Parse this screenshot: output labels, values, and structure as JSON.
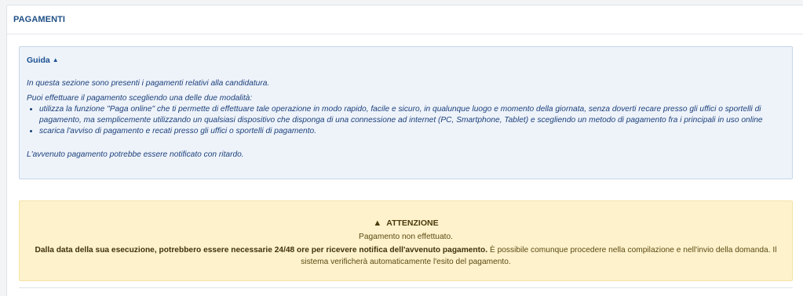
{
  "panel": {
    "title": "PAGAMENTI"
  },
  "guide": {
    "toggle_label": "Guida",
    "toggle_icon": "caret-up-icon",
    "intro": "In questa sezione sono presenti i pagamenti relativi alla candidatura.",
    "methods_intro": "Puoi effettuare il pagamento scegliendo una delle due modalità:",
    "methods": [
      "utilizza la funzione \"Paga online\" che ti permette di effettuare tale operazione in modo rapido, facile e sicuro, in qualunque luogo e momento della giornata, senza doverti recare presso gli uffici o sportelli di pagamento, ma semplicemente utilizzando un qualsiasi dispositivo che disponga di una connessione ad internet (PC, Smartphone, Tablet) e scegliendo un metodo di pagamento fra i principali in uso online",
      "scarica l'avviso di pagamento e recati presso gli uffici o sportelli di pagamento."
    ],
    "note": "L'avvenuto pagamento potrebbe essere notificato con ritardo."
  },
  "alert": {
    "icon": "warning-icon",
    "title": "ATTENZIONE",
    "status": "Pagamento non effettuato.",
    "note_bold": "Dalla data della sua esecuzione, potrebbero essere necessarie 24/48 ore per ricevere notifica dell'avvenuto pagamento.",
    "note_rest": " È possibile comunque procedere nella compilazione e nell'invio della domanda. Il sistema verificherà automaticamente l'esito del pagamento."
  },
  "colors": {
    "title": "#1f4f86",
    "guide_bg": "#eef3fa",
    "guide_text": "#1a3f7a",
    "alert_bg": "#fdf2cc",
    "alert_text": "#5c4a12"
  }
}
